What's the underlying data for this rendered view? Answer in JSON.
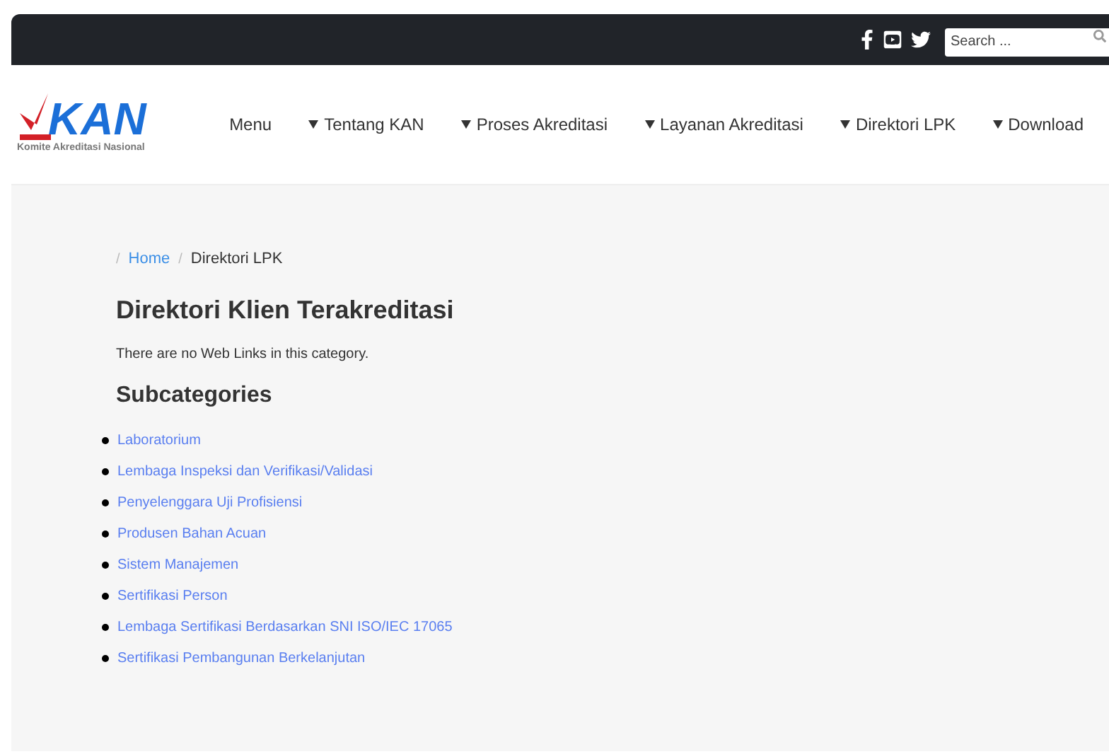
{
  "top_bar": {
    "search": {
      "placeholder": "Search ..."
    }
  },
  "logo": {
    "wordmark": "KAN",
    "tagline": "Komite Akreditasi Nasional"
  },
  "nav": [
    {
      "label": "Menu",
      "dropdown": false
    },
    {
      "label": "Tentang KAN",
      "dropdown": true
    },
    {
      "label": "Proses Akreditasi",
      "dropdown": true
    },
    {
      "label": "Layanan Akreditasi",
      "dropdown": true
    },
    {
      "label": "Direktori LPK",
      "dropdown": true
    },
    {
      "label": "Download",
      "dropdown": true
    }
  ],
  "breadcrumb_separator": "/",
  "breadcrumb": [
    {
      "label": "Home",
      "kind": "link"
    },
    {
      "label": "Direktori LPK",
      "kind": "current"
    }
  ],
  "title": "Direktori Klien Terakreditasi",
  "notice": "There are no Web Links in this category.",
  "subcategories_heading": "Subcategories",
  "subcategories": [
    "Laboratorium",
    "Lembaga Inspeksi dan Verifikasi/Validasi",
    "Penyelenggara Uji Profisiensi",
    "Produsen Bahan Acuan",
    "Sistem Manajemen",
    "Sertifikasi Person",
    "Lembaga Sertifikasi Berdasarkan SNI ISO/IEC 17065",
    "Sertifikasi Pembangunan Berkelanjutan"
  ]
}
